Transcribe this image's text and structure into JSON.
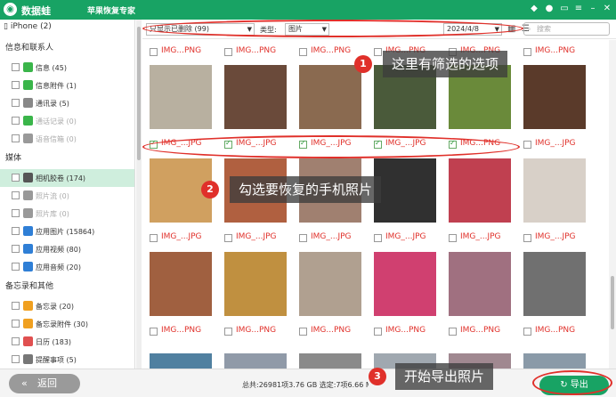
{
  "app": {
    "name": "数据蛙",
    "subtitle": "苹果恢复专家",
    "logo": "◉"
  },
  "title_icons": [
    "gem-icon",
    "user-icon",
    "chat-icon",
    "menu-icon",
    "minimize-icon",
    "close-icon"
  ],
  "sidebar": {
    "device": "iPhone (2)",
    "sections": [
      {
        "title": "信息和联系人",
        "items": [
          {
            "label": "信息 (45)",
            "icon": "message-icon",
            "color": "#3ab54a"
          },
          {
            "label": "信息附件 (1)",
            "icon": "message-attach-icon",
            "color": "#3ab54a"
          },
          {
            "label": "通讯录 (5)",
            "icon": "contacts-icon",
            "color": "#888888"
          },
          {
            "label": "通话记录 (0)",
            "icon": "call-log-icon",
            "color": "#3ab54a",
            "dim": true
          },
          {
            "label": "语音信箱 (0)",
            "icon": "voicemail-icon",
            "color": "#999999",
            "dim": true
          }
        ]
      },
      {
        "title": "媒体",
        "items": [
          {
            "label": "相机胶卷 (174)",
            "icon": "camera-roll-icon",
            "color": "#555555",
            "selected": true
          },
          {
            "label": "照片流 (0)",
            "icon": "photo-stream-icon",
            "color": "#999999",
            "dim": true
          },
          {
            "label": "照片库 (0)",
            "icon": "photo-library-icon",
            "color": "#999999",
            "dim": true
          },
          {
            "label": "应用图片 (15864)",
            "icon": "app-photos-icon",
            "color": "#2f7fd6"
          },
          {
            "label": "应用视频 (80)",
            "icon": "app-videos-icon",
            "color": "#2f7fd6"
          },
          {
            "label": "应用音频 (20)",
            "icon": "app-audio-icon",
            "color": "#2f7fd6"
          }
        ]
      },
      {
        "title": "备忘录和其他",
        "items": [
          {
            "label": "备忘录 (20)",
            "icon": "notes-icon",
            "color": "#f0a020"
          },
          {
            "label": "备忘录附件 (30)",
            "icon": "notes-attach-icon",
            "color": "#f0a020"
          },
          {
            "label": "日历 (183)",
            "icon": "calendar-icon",
            "color": "#e05050"
          },
          {
            "label": "提醒事项 (5)",
            "icon": "reminders-icon",
            "color": "#777777"
          }
        ]
      }
    ]
  },
  "filter": {
    "show": "只显示已删除 (99)",
    "type_label": "类型:",
    "type_value": "图片",
    "date": "2024/4/8",
    "search_placeholder": "搜索"
  },
  "grid": {
    "rows": [
      {
        "captions": [
          "IMG...PNG",
          "IMG...PNG",
          "IMG...PNG",
          "IMG...PNG",
          "IMG...PNG",
          "IMG...PNG"
        ],
        "checked": [
          false,
          false,
          false,
          false,
          false,
          false
        ]
      },
      {
        "captions": [
          "IMG_...JPG",
          "IMG_...JPG",
          "IMG_...JPG",
          "IMG_...JPG",
          "IMG...PNG",
          "IMG_...JPG"
        ],
        "checked": [
          true,
          true,
          true,
          true,
          true,
          false
        ]
      },
      {
        "captions": [
          "IMG_...JPG",
          "IMG_...JPG",
          "IMG_...JPG",
          "IMG_...JPG",
          "IMG_...JPG",
          "IMG_...JPG"
        ],
        "checked": [
          false,
          false,
          false,
          false,
          false,
          false
        ]
      },
      {
        "captions": [
          "IMG...PNG",
          "IMG...PNG",
          "IMG...PNG",
          "IMG...PNG",
          "IMG...PNG",
          "IMG...PNG"
        ],
        "checked": [
          false,
          false,
          false,
          false,
          false,
          false
        ]
      }
    ],
    "thumb_colors": [
      [
        "#b8b0a0",
        "#6a4a3a",
        "#8a6a50",
        "#4a5a3a",
        "#6a8a3a",
        "#5a3a2a"
      ],
      [
        "#d0a060",
        "#b06040",
        "#a08070",
        "#303030",
        "#c04050",
        "#d8d0c8"
      ],
      [
        "#a06040",
        "#c09040",
        "#b0a090",
        "#d04070",
        "#a07080",
        "#707070"
      ],
      [
        "#5080a0",
        "#909aa8",
        "#8a8a8a",
        "#a0a8b0",
        "#a08890",
        "#8a9aa8"
      ]
    ]
  },
  "callouts": [
    {
      "num": "1",
      "text": "这里有筛选的选项"
    },
    {
      "num": "2",
      "text": "勾选要恢复的手机照片"
    },
    {
      "num": "3",
      "text": "开始导出照片"
    }
  ],
  "bottom": {
    "back": "返回",
    "back_icon": "«",
    "summary": "总共:26981项3.76 GB 选定:7项6.66 M",
    "export": "导出",
    "export_icon": "↻"
  }
}
